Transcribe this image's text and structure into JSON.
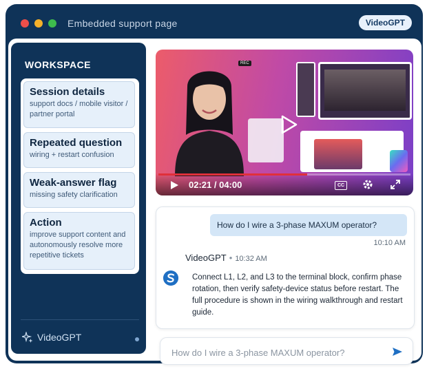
{
  "window": {
    "title": "Embedded support page",
    "brand_pill": "VideoGPT"
  },
  "sidebar": {
    "heading": "WORKSPACE",
    "cards": [
      {
        "title": "Session details",
        "subtitle": "support docs / mobile visitor / partner portal"
      },
      {
        "title": "Repeated question",
        "subtitle": "wiring + restart confusion"
      },
      {
        "title": "Weak-answer flag",
        "subtitle": "missing safety clarification"
      },
      {
        "title": "Action",
        "subtitle": "improve support content and autonomously resolve more repetitive tickets"
      }
    ],
    "brand": "VideoGPT"
  },
  "video": {
    "time": "02:21 / 04:00",
    "progress_fraction": 0.59,
    "rec_label": "REC",
    "cc_label": "CC"
  },
  "chat": {
    "user_message": "How do I wire a 3-phase MAXUM operator?",
    "user_time": "10:10 AM",
    "bot_name": "VideoGPT",
    "bot_time": "10:32 AM",
    "bot_message": "Connect L1, L2, and L3 to the terminal block, confirm phase rotation, then verify safety-device status before restart. The full procedure is shown in the wiring walkthrough and restart guide."
  },
  "input": {
    "placeholder": "How do I wire a 3-phase MAXUM operator?"
  },
  "colors": {
    "navy": "#0f3358",
    "card_bg": "#e6f0fa",
    "bubble": "#d4e6f7",
    "accent_red": "#e0303a"
  }
}
